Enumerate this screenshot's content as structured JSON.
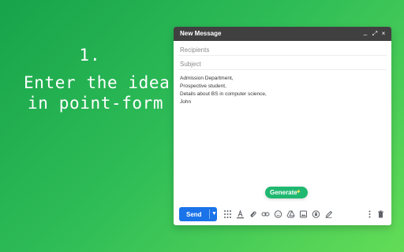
{
  "hero": {
    "step_number": "1.",
    "line_1": "Enter the idea",
    "line_2": "in point-form"
  },
  "compose": {
    "window_title": "New Message",
    "window_controls": {
      "minimize_icon": "minimize-icon",
      "expand_icon": "expand-icon",
      "close_icon": "close-icon"
    },
    "fields": {
      "recipients_placeholder": "Recipients",
      "subject_placeholder": "Subject"
    },
    "body_lines": [
      "Admission Department,",
      "Prospective student,",
      "Details about BS in computer science,",
      "John"
    ],
    "generate_button": {
      "label": "Generate",
      "icon": "sparkles-icon"
    },
    "toolbar": {
      "send_label": "Send",
      "send_options_icon": "caret-down-icon",
      "icons": [
        "formatting-icon",
        "text-color-icon",
        "attachment-icon",
        "link-icon",
        "emoji-icon",
        "drive-icon",
        "photo-icon",
        "confidential-mode-icon",
        "signature-icon",
        "more-options-icon",
        "discard-draft-icon"
      ]
    }
  },
  "colors": {
    "background_start": "#17a34a",
    "background_end": "#63dc57",
    "header": "#404040",
    "send_button": "#1a73e8",
    "generate_button": "#1fb870",
    "toolbar_icon": "#5f6368"
  }
}
